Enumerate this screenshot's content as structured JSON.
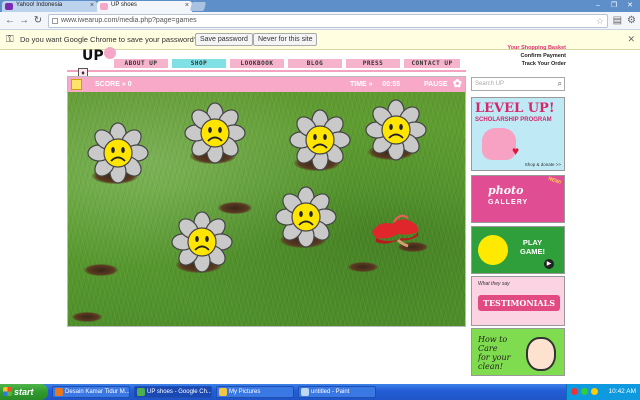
{
  "browser": {
    "tabs": [
      {
        "label": "Yahoo! Indonesia",
        "icon": "yahoo-icon"
      },
      {
        "label": "UP shoes",
        "icon": "up-page-icon"
      }
    ],
    "url": "www.iwearup.com/media.php?page=games",
    "infobar": {
      "message": "Do you want Google Chrome to save your password?",
      "save_button": "Save password",
      "never_button": "Never for this site"
    }
  },
  "site": {
    "logo": "UP",
    "account_links": [
      "Your Shopping Basket",
      "Confirm Payment",
      "Track Your Order"
    ],
    "menu": [
      {
        "label": "ABOUT UP",
        "color": "pink"
      },
      {
        "label": "SHOP",
        "color": "cyan"
      },
      {
        "label": "LOOKBOOK",
        "color": "pink"
      },
      {
        "label": "BLOG",
        "color": "pink"
      },
      {
        "label": "PRESS",
        "color": "pink"
      },
      {
        "label": "CONTACT UP",
        "color": "pink"
      }
    ],
    "search_placeholder": "Search UP"
  },
  "game": {
    "score_label": "SCORE",
    "score_value": "0",
    "time_label": "TIME",
    "time_value": "00:55",
    "pause_label": "PAUSE",
    "flower_colors": {
      "petal": "#c9c9c9",
      "center": "#ffe500"
    }
  },
  "sidebar_banners": {
    "level_up": {
      "title": "LEVEL UP!",
      "subtitle": "SCHOLARSHIP PROGRAM",
      "cta": "Shop & donate >>"
    },
    "photo_gallery": {
      "title": "photo",
      "subtitle": "GALLERY",
      "badge": "NEW!"
    },
    "play_game": {
      "line1": "PLAY",
      "line2": "GAME!"
    },
    "testimonials": {
      "kicker": "What they say",
      "title": "TESTIMONIALS"
    },
    "care": {
      "line1": "How to",
      "line2": "Care",
      "line3": "for your",
      "line4": "clean!"
    }
  },
  "taskbar": {
    "start_label": "start",
    "tasks": [
      "Desain Kamar Tidur M...",
      "UP shoes - Google Ch...",
      "My Pictures",
      "untitled - Paint"
    ],
    "clock": "10:42 AM"
  }
}
